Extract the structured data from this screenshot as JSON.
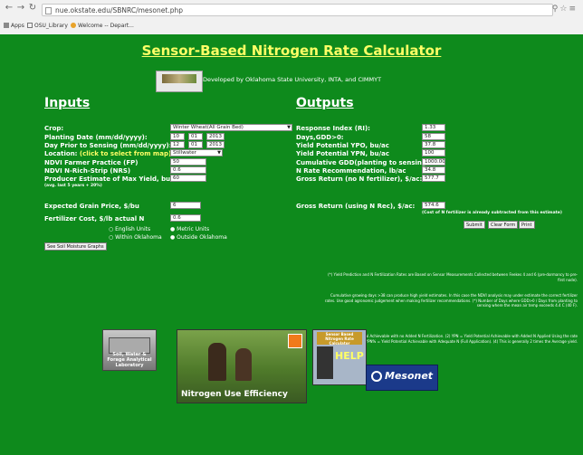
{
  "browser": {
    "url": "nue.okstate.edu/SBNRC/mesonet.php",
    "bookmarks": [
      "Apps",
      "OSU_Library",
      "Welcome -- Depart..."
    ]
  },
  "header": {
    "title": "Sensor-Based Nitrogen Rate Calculator",
    "developed_by": "Developed by Oklahoma State University, INTA, and CIMMYT"
  },
  "inputs": {
    "heading": "Inputs",
    "crop_label": "Crop:",
    "crop_value": "Winter Wheat(All Grain Bed)",
    "planting_date_label": "Planting Date (mm/dd/yyyy):",
    "planting_date": [
      "10",
      "01",
      "2013"
    ],
    "sensing_label": "Day Prior to Sensing (mm/dd/yyyy):",
    "sensing_date": [
      "12",
      "01",
      "2013"
    ],
    "location_label": "Location:",
    "location_link": "(click to select from map)",
    "location_value": "Stillwater",
    "ndvi_fp_label": "NDVI Farmer Practice (FP)",
    "ndvi_fp_value": "50",
    "ndvi_nrs_label": "NDVI N-Rich-Strip (NRS)",
    "ndvi_nrs_value": "0.6",
    "producer_label": "Producer Estimate of Max Yield, bu/ac:",
    "producer_note": "(avg. last 5 years + 20%)",
    "producer_value": "60",
    "grain_price_label": "Expected Grain Price, $/bu",
    "grain_price_value": "6",
    "fert_cost_label": "Fertilizer Cost, $/lb actual N",
    "fert_cost_value": "0.6",
    "units_english": "English Units",
    "units_metric": "Metric Units",
    "within_ok": "Within Oklahoma",
    "outside_ok": "Outside Oklahoma",
    "mesonet_button": "See Soil Moisture Graphs"
  },
  "outputs": {
    "heading": "Outputs",
    "ri_label": "Response Index (RI):",
    "ri_value": "1.33",
    "gdd_label": "Days,GDD>0:",
    "gdd_value": "58",
    "ypo_label": "Yield Potential YPO, bu/ac",
    "ypo_value": "37.8",
    "ypn_label": "Yield Potential YPN, bu/ac",
    "ypn_value": "100",
    "cgdd_label": "Cumulative GDD(planting to sensing):",
    "cgdd_value": "1000.00",
    "nrate_label": "N Rate Recommendation, lb/ac",
    "nrate_value": "34.8",
    "gross_no_n_label": "Gross Return (no N fertilizer), $/ac:",
    "gross_no_n_value": "577.7",
    "gross_n_label": "Gross Return (using N Rec), $/ac:",
    "gross_n_value": "574.6",
    "gross_n_note": "(Cost of N fertilizer is already subtracted from this estimate)",
    "submit": "Submit",
    "clear_form": "Clear Form",
    "print": "Print"
  },
  "notes": {
    "n1": "(*) Yield Prediction and N Fertilization Rates are Based on Sensor Measurements Collected between Feekes 4 and 6 (pre-dormancy to pre-first node).",
    "n2": "Cumulative growing days >38 can produce high yield estimates. In this case the NDVI analysis may under estimate the correct fertilizer rates. Use good agronomic judgement when making fertilizer recommendations. (*) Number of Days where GDD>0 / Days from planting to sensing where the mean air temp exceeds 4.4 C (40 F).",
    "n3": "(1) YPO = Yield Potential Achievable with no Added N Fertilization. (2) YPN = Yield Potential Achievable with Added N Applied Using the rate recommended. (3) YPN% = Yield Potential Achievable with Adequate N (Full Application). (4) This is generally 2 times the Average yield."
  },
  "banners": {
    "soil_lab": "Soil, Water & Forage Analytical Laboratory",
    "nue": "Nitrogen Use Efficiency",
    "help": "HELP",
    "sbnrc_small": "Sensor Based Nitrogen Rate Calculator",
    "mesonet": "Mesonet"
  }
}
